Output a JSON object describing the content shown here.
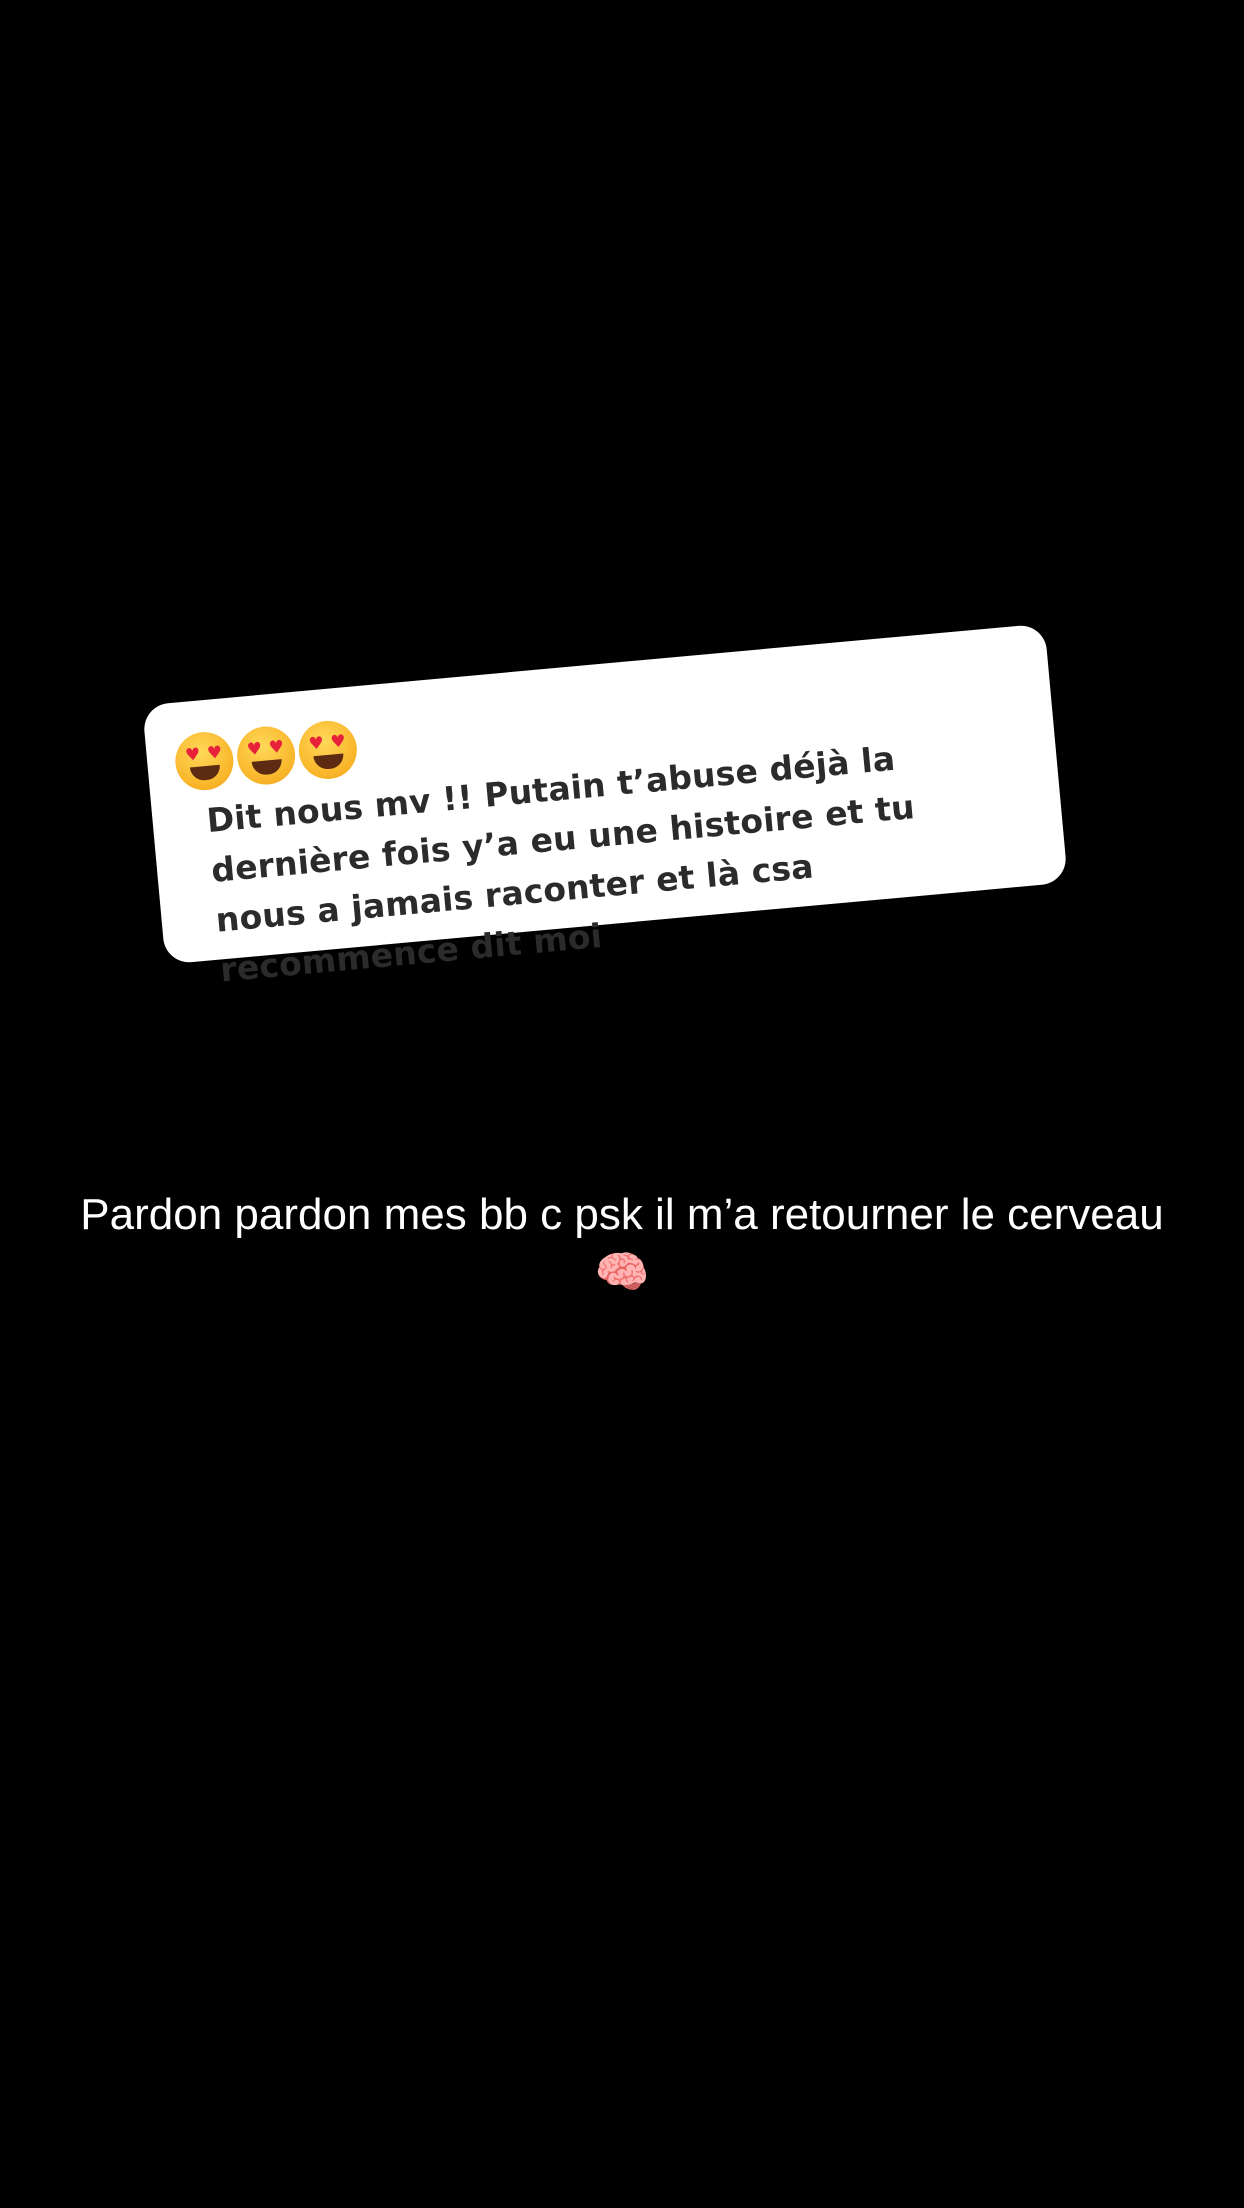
{
  "question_card": {
    "emojis": [
      "heart-eyes-emoji",
      "heart-eyes-emoji",
      "heart-eyes-emoji"
    ],
    "text": "Dit nous mv !! Putain t’abuse déjà la dernière fois y’a eu une histoire et tu nous a jamais raconter et là csa recommence dit moi",
    "background_color": "#ffffff",
    "text_color": "#2b2b2b"
  },
  "caption": {
    "text": "Pardon pardon mes bb c psk il m’a retourner le cerveau 🧠",
    "color": "#ffffff"
  },
  "background_color": "#000000"
}
